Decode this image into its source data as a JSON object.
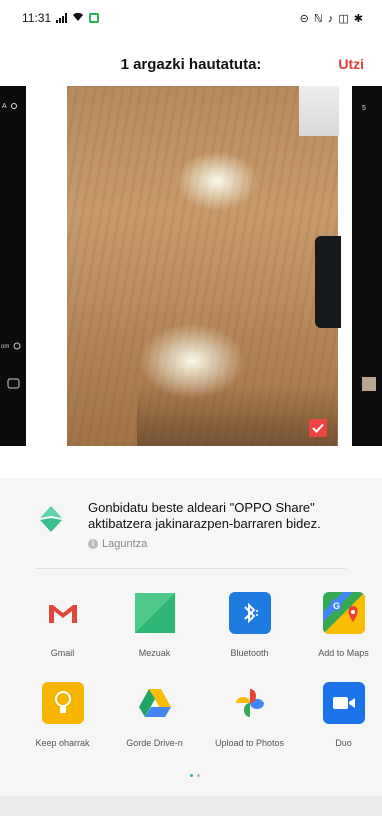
{
  "status_bar": {
    "time": "11:31",
    "right_icons": "⊝ ℕ ♪ ◫ ✱"
  },
  "header": {
    "title": "1 argazki hautatuta:",
    "cancel": "Utzi"
  },
  "share_banner": {
    "text": "Gonbidatu beste aldeari \"OPPO Share\" aktibatzera jakinarazpen-barraren bidez.",
    "help_label": "Laguntza",
    "help_icon": "i"
  },
  "apps": [
    {
      "label": "Gmail",
      "icon": "gmail-icon"
    },
    {
      "label": "Mezuak",
      "icon": "messages-icon"
    },
    {
      "label": "Bluetooth",
      "icon": "bluetooth-icon"
    },
    {
      "label": "Add to Maps",
      "icon": "maps-icon"
    },
    {
      "label": "Keep oharrak",
      "icon": "keep-icon"
    },
    {
      "label": "Gorde Drive-n",
      "icon": "drive-icon"
    },
    {
      "label": "Upload to Photos",
      "icon": "photos-icon"
    },
    {
      "label": "Duo",
      "icon": "duo-icon"
    }
  ],
  "colors": {
    "accent_red": "#e53935",
    "checkbox_red": "#ef4444",
    "bluetooth_blue": "#1e7be0",
    "keep_yellow": "#f7b500",
    "duo_blue": "#1a73e8"
  }
}
